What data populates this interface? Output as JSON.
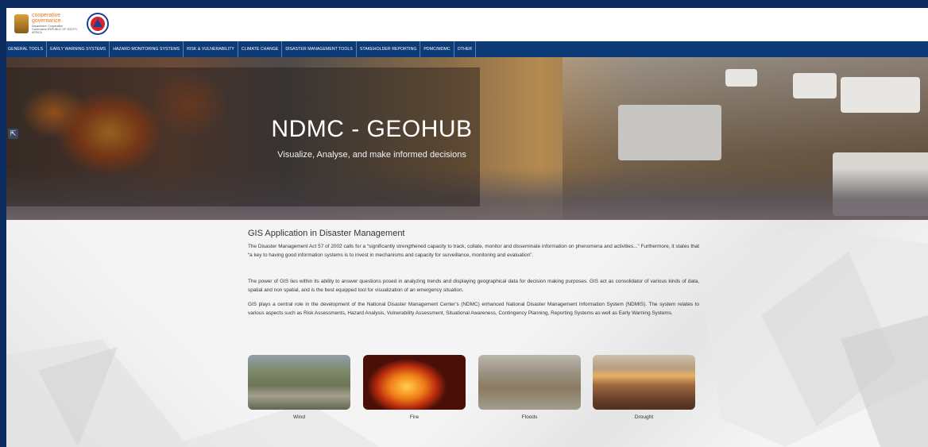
{
  "header": {
    "gov_logo_text": "cooperative governance",
    "gov_logo_sub": "Department: Cooperative Governance REPUBLIC OF SOUTH AFRICA"
  },
  "nav": {
    "items": [
      "GENERAL TOOLS",
      "EARLY WARNING SYSTEMS",
      "HAZARD MONITORING SYSTEMS",
      "RISK & VULNERABILITY",
      "CLIMATE CHANGE",
      "DISASTER MANAGEMENT TOOLS",
      "STAKEHOLDER REPORTING",
      "PDMC/MDMC",
      "OTHER"
    ]
  },
  "hero": {
    "title": "NDMC - GEOHUB",
    "subtitle": "Visualize, Analyse, and make informed decisions"
  },
  "main": {
    "title": "GIS Application in Disaster Management",
    "paragraphs": [
      "The Disaster Management Act 57 of 2002 calls for a “significantly strengthened capacity to track, collate, monitor and disseminate information on phenomena and activities...” Furthermore, it states that “a key to having good information systems is to invest in mechanisms and capacity for surveillance, monitoring and evaluation”.",
      "The power of GIS lies within its ability to answer questions posed in analyzing trends and displaying geographical data for decision making purposes. GIS act as consolidator of various kinds of data, spatial and non spatial, and is the best equipped tool for visualization of an emergency situation.",
      "GIS plays a central role in the development of the National Disaster Management Center’s (NDMC) enhanced National Disaster Management Information System (NDMIS). The system relates to various aspects such as Risk Assessments, Hazard Analysis, Vulnerability Assessment, Situational Awareness, Contingency Planning, Reporting Systems as well as Early Warning Systems."
    ]
  },
  "gallery": {
    "items": [
      {
        "label": "Wind"
      },
      {
        "label": "Fire"
      },
      {
        "label": "Floods"
      },
      {
        "label": "Drought"
      }
    ]
  },
  "colors": {
    "page_bg": "#0b2a5e",
    "nav_bg": "#0c3b78",
    "accent_orange": "#e0771f"
  }
}
